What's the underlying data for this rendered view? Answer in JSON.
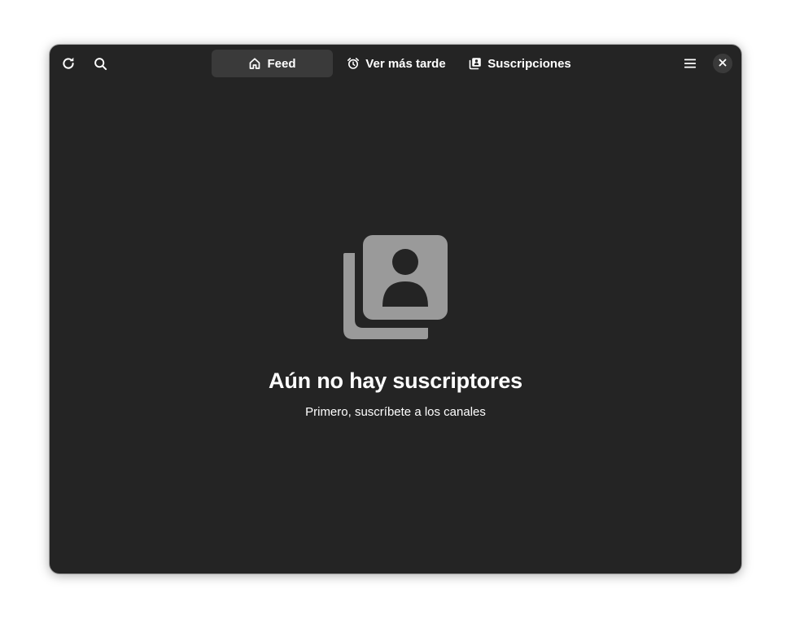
{
  "headerbar": {
    "refresh_icon": "refresh-icon",
    "search_icon": "search-icon",
    "menu_icon": "hamburger-menu-icon",
    "close_icon": "close-icon"
  },
  "tabs": [
    {
      "label": "Feed",
      "icon": "home-icon",
      "active": true
    },
    {
      "label": "Ver más tarde",
      "icon": "alarm-clock-icon",
      "active": false
    },
    {
      "label": "Suscripciones",
      "icon": "subscriptions-icon",
      "active": false
    }
  ],
  "empty_state": {
    "icon": "subscriptions-icon",
    "title": "Aún no hay suscriptores",
    "description": "Primero, suscríbete a los canales"
  },
  "colors": {
    "window_bg": "#242424",
    "active_tab_bg": "#3a3a3a",
    "text": "#ffffff",
    "icon_gray": "#9a9a9a"
  }
}
